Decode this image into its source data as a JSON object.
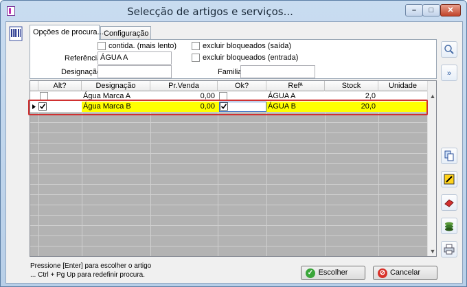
{
  "window": {
    "title": "Selecção de artigos e serviços..."
  },
  "tabs": [
    {
      "label": "Opções de procura..."
    },
    {
      "label": "Configuração"
    }
  ],
  "filters": {
    "contida_label": "contida. (mais lento)",
    "excluir_saida_label": "excluir bloqueados (saída)",
    "excluir_entrada_label": "excluir bloqueados (entrada)",
    "referencia_label": "Referência",
    "referencia_value": "ÁGUA A",
    "designacao_label": "Designação",
    "designacao_value": "",
    "familia_label": "Familia",
    "familia_value": ""
  },
  "table": {
    "columns": [
      "Alt?",
      "Designação",
      "Pr.Venda",
      "Ok?",
      "Refª",
      "Stock",
      "Unidade"
    ],
    "rows": [
      {
        "alt": false,
        "designacao": "Água Marca A",
        "pr_venda": "0,00",
        "ok": false,
        "ref": "ÁGUA A",
        "stock": "2,0",
        "unidade": ""
      },
      {
        "alt": true,
        "designacao": "Água Marca B",
        "pr_venda": "0,00",
        "ok": true,
        "ref": "ÁGUA B",
        "stock": "20,0",
        "unidade": ""
      }
    ]
  },
  "status": {
    "line1": "Pressione [Enter] para escolher o artigo",
    "line2": "... Ctrl + Pg Up para redefinir procura."
  },
  "buttons": {
    "escolher": "Escolher",
    "cancelar": "Cancelar"
  },
  "icons": [
    "search-icon",
    "expand-down-icon",
    "copy-icon",
    "edit-icon",
    "eraser-icon",
    "stack-icon",
    "print-icon"
  ],
  "colors": {
    "selected_row": "#ffff00",
    "selection_outline": "#d03030"
  }
}
